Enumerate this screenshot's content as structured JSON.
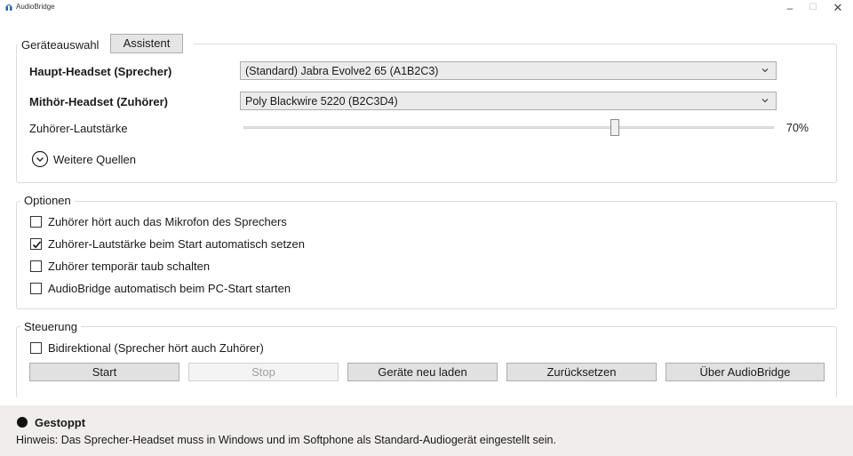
{
  "window": {
    "title": "AudioBridge",
    "minimize": "–",
    "maximize": "☐",
    "close": "✕"
  },
  "devices": {
    "section_title": "Geräteauswahl",
    "assistant_tab": "Assistent",
    "main_headset_label": "Haupt-Headset (Sprecher)",
    "main_headset_value": "(Standard) Jabra Evolve2 65 (A1B2C3)",
    "listen_headset_label": "Mithör-Headset (Zuhörer)",
    "listen_headset_value": "Poly Blackwire 5220 (B2C3D4)",
    "volume_label": "Zuhörer-Lautstärke",
    "volume_level": 0.7,
    "volume_value": "70%",
    "more_sources": "Weitere Quellen"
  },
  "options": {
    "section_title": "Optionen",
    "items": [
      {
        "label": "Zuhörer hört auch das Mikrofon des Sprechers",
        "checked": false
      },
      {
        "label": "Zuhörer-Lautstärke beim Start automatisch setzen",
        "checked": true
      },
      {
        "label": "Zuhörer temporär taub schalten",
        "checked": false
      },
      {
        "label": "AudioBridge automatisch beim PC-Start starten",
        "checked": false
      }
    ]
  },
  "control": {
    "section_title": "Steuerung",
    "bidirectional_label": "Bidirektional (Sprecher hört auch Zuhörer)",
    "bidirectional_checked": false,
    "buttons": {
      "start": "Start",
      "stop": "Stop",
      "reload": "Geräte neu laden",
      "reset": "Zurücksetzen",
      "about": "Über AudioBridge"
    }
  },
  "status": {
    "state": "Gestoppt",
    "hint": "Hinweis: Das Sprecher-Headset muss in Windows und im Softphone als Standard-Audiogerät eingestellt sein."
  },
  "colors": {
    "status_bar_bg": "#f0edec",
    "button_bg": "#e1e1e1",
    "combo_bg": "#ebebeb",
    "border": "#dcdcdc",
    "app_icon": "#1f5fb4"
  }
}
